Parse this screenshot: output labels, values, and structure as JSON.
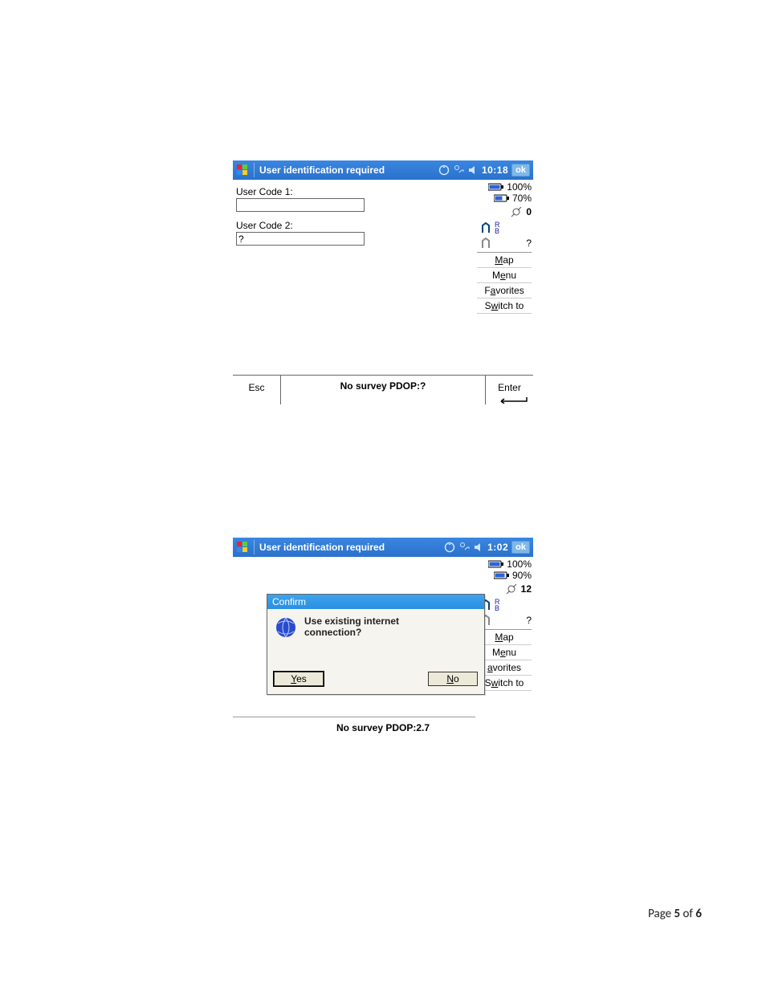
{
  "screenshot1": {
    "titlebar": {
      "app_title": "User identification required",
      "time": "10:18",
      "ok_label": "ok"
    },
    "form": {
      "user_code_1_label": "User Code 1:",
      "user_code_1_value": "",
      "user_code_2_label": "User Code 2:",
      "user_code_2_value": "?"
    },
    "sidebar": {
      "battery_main": "100%",
      "battery_controller": "70%",
      "satellites": "0",
      "receiver_status": "?",
      "items": [
        {
          "label": "Map",
          "hotkey_index": 0
        },
        {
          "label": "Menu",
          "hotkey_index": 1
        },
        {
          "label": "Favorites",
          "hotkey_index": 1
        },
        {
          "label": "Switch to",
          "hotkey_index": 1
        }
      ]
    },
    "bottombar": {
      "esc_label": "Esc",
      "status": "No survey  PDOP:?",
      "enter_label": "Enter"
    }
  },
  "screenshot2": {
    "titlebar": {
      "app_title": "User identification required",
      "time": "1:02",
      "ok_label": "ok"
    },
    "sidebar": {
      "battery_main": "100%",
      "battery_controller": "90%",
      "satellites": "12",
      "receiver_status": "?",
      "items": [
        {
          "label": "Map",
          "hotkey_index": 0
        },
        {
          "label": "Menu",
          "hotkey_index": 1
        },
        {
          "label": "avorites",
          "hotkey_index": 0
        },
        {
          "label": "Switch to",
          "hotkey_index": 1
        }
      ]
    },
    "dialog": {
      "title": "Confirm",
      "message_line1": "Use existing internet",
      "message_line2": "connection?",
      "yes_label": "Yes",
      "no_label": "No"
    },
    "status_line": "No survey  PDOP:2.7"
  },
  "page_footer": {
    "prefix": "Page ",
    "current": "5",
    "sep": " of ",
    "total": "6"
  }
}
